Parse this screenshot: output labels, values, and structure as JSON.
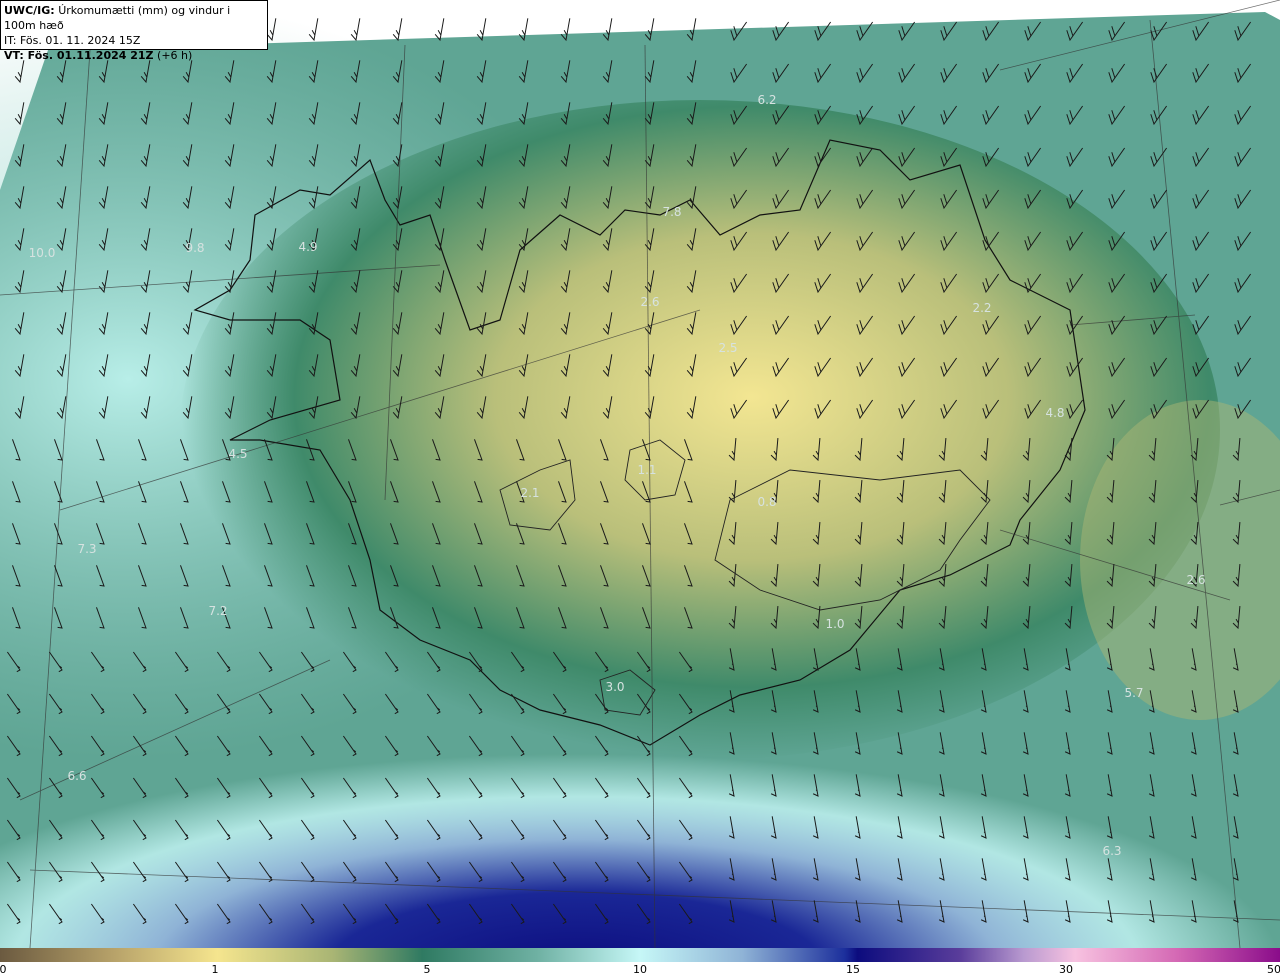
{
  "header": {
    "model": "UWC/IG:",
    "description": "Úrkomumætti (mm) og vindur i 100m hæð",
    "initial_time": "IT: Fös. 01. 11. 2024 15Z",
    "valid_time_label": "VT: Fös. 01.11.2024 21Z",
    "valid_offset": "(+6 h)"
  },
  "map": {
    "region": "Iceland",
    "field": "precipitable water",
    "overlay": "wind barbs",
    "value_labels": [
      "6.2",
      "10.0",
      "9.8",
      "4.9",
      "7.8",
      "2.6",
      "2.5",
      "2.2",
      "4.8",
      "4.5",
      "2.1",
      "1.1",
      "0.8",
      "1.0",
      "7.3",
      "7.2",
      "2.6",
      "3.0",
      "5.7",
      "6.6",
      "6.3"
    ]
  },
  "colorbar": {
    "ticks": [
      "0",
      "1",
      "5",
      "10",
      "15",
      "30",
      "50"
    ],
    "colors": [
      "#6b5a40",
      "#f5e58e",
      "#2f7a62",
      "#c6f7f7",
      "#0c0c7e",
      "#f7c2e0",
      "#8a0c8a"
    ]
  }
}
